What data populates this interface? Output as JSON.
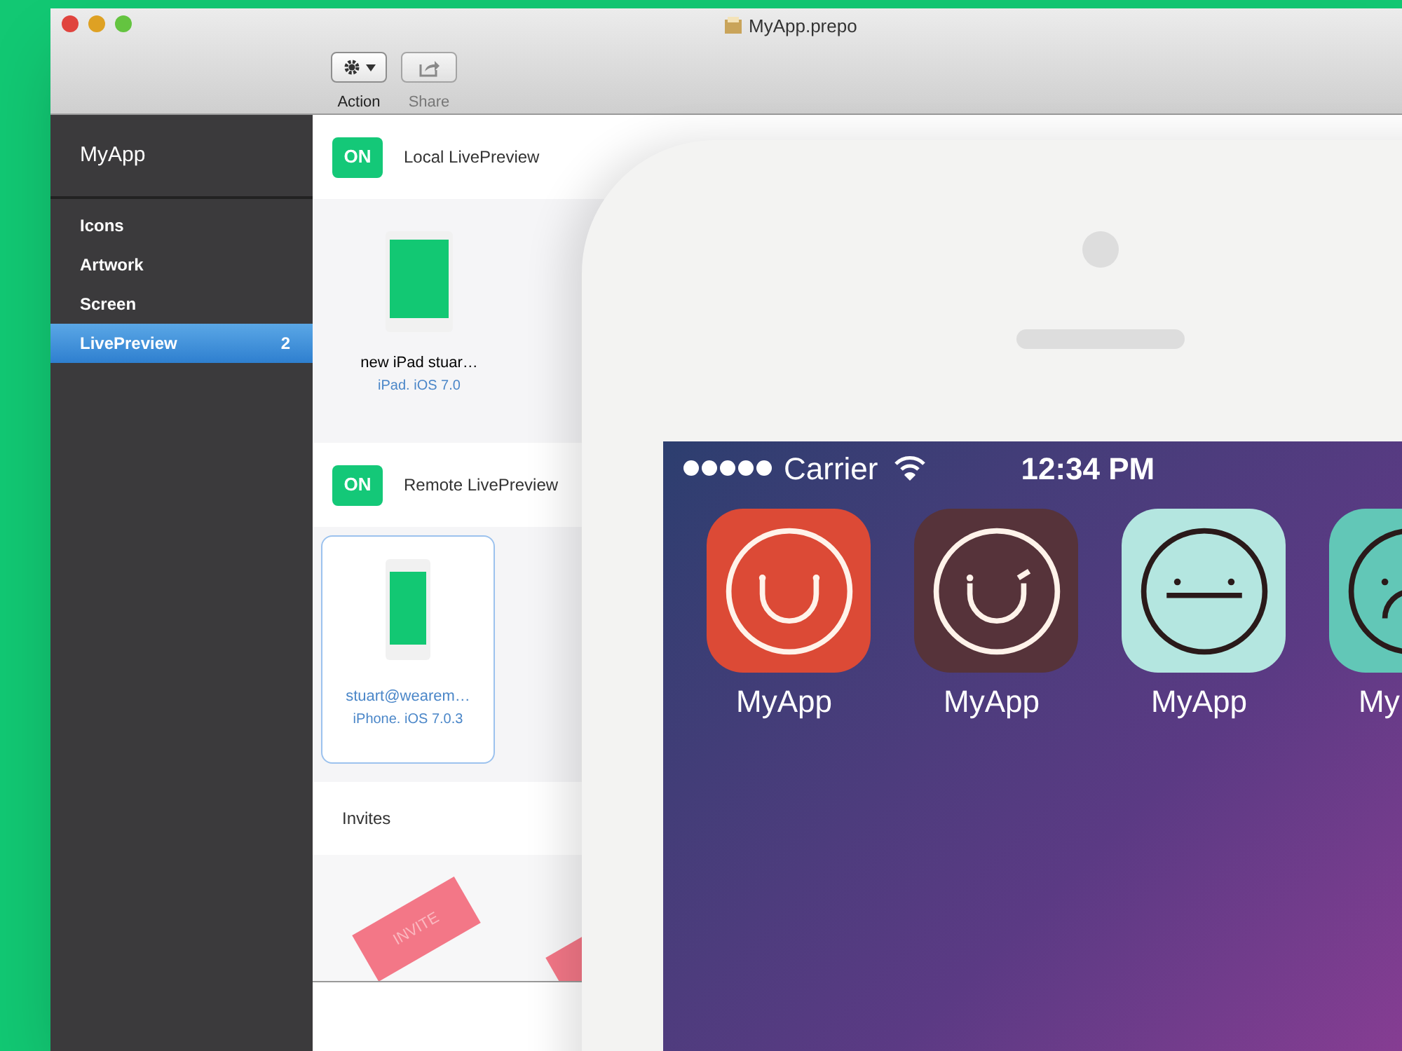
{
  "window": {
    "title": "MyApp.prepo"
  },
  "toolbar": [
    {
      "label": "Action",
      "disabled": false,
      "kind": "action"
    },
    {
      "label": "Share",
      "disabled": true,
      "kind": "share"
    }
  ],
  "sidebar": {
    "title": "MyApp",
    "items": [
      {
        "label": "Icons",
        "selected": false
      },
      {
        "label": "Artwork",
        "selected": false
      },
      {
        "label": "Screen",
        "selected": false
      },
      {
        "label": "LivePreview",
        "selected": true,
        "badge": "2"
      }
    ]
  },
  "sections": [
    {
      "toggle": {
        "label": "ON",
        "on": true
      },
      "title": "Local LivePreview",
      "devices": [
        {
          "kind": "ipad",
          "name": "new iPad stuar…",
          "detail": "iPad. iOS 7.0",
          "selected": false
        }
      ]
    },
    {
      "toggle": {
        "label": "ON",
        "on": true
      },
      "title": "Remote LivePreview",
      "devices": [
        {
          "kind": "iphone",
          "name": "stuart@wearem…",
          "detail": "iPhone. iOS 7.0.3",
          "selected": true
        }
      ]
    }
  ],
  "invites": {
    "title": "Invites",
    "tickets": [
      {
        "label": "INVITE"
      }
    ]
  },
  "phone": {
    "carrier": "Carrier",
    "time": "12:34 PM",
    "apps": [
      {
        "label": "MyApp",
        "color": "#dc4a36",
        "kind": "smile"
      },
      {
        "label": "MyApp",
        "color": "#56333a",
        "kind": "wink"
      },
      {
        "label": "MyApp",
        "color": "#b4e6e0",
        "kind": "neutral"
      },
      {
        "label": "My",
        "color": "#62c7b7",
        "kind": "sad"
      }
    ]
  }
}
